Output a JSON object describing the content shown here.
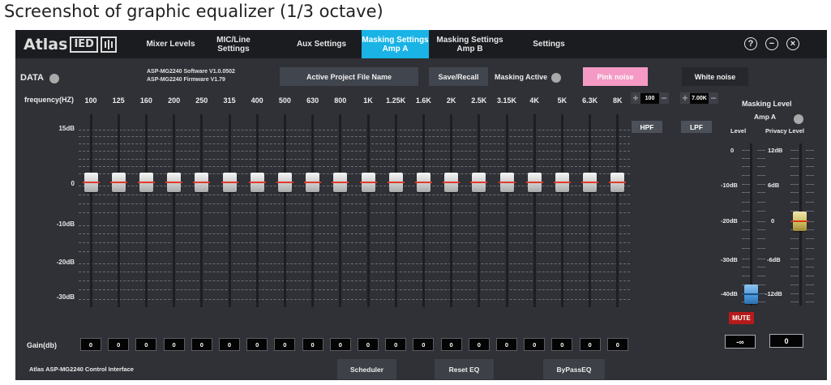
{
  "caption": "Screenshot of graphic equalizer (1/3 octave)",
  "logo": {
    "text": "Atlas",
    "box_text": "IED"
  },
  "nav": {
    "tabs": [
      {
        "label": "Mixer Levels",
        "active": false
      },
      {
        "label": "MIC/Line\nSettings",
        "active": false
      },
      {
        "label": "Aux Settings",
        "active": false
      },
      {
        "label": "Masking Settings\nAmp A",
        "active": true
      },
      {
        "label": "Masking Settings\nAmp B",
        "active": false
      },
      {
        "label": "Settings",
        "active": false
      }
    ],
    "icons": [
      "help-icon",
      "minimize-icon",
      "close-icon"
    ]
  },
  "status": {
    "data_label": "DATA",
    "software": "ASP-MG2240 Software V1.0.0502",
    "firmware": "ASP-MG2240 Firmware V1.79",
    "project_button": "Active Project File Name",
    "save_recall": "Save/Recall",
    "masking_active": "Masking Active",
    "pink_noise": "Pink noise",
    "white_noise": "White noise"
  },
  "eq": {
    "frequency_label": "frequency(HZ)",
    "frequencies": [
      "100",
      "125",
      "160",
      "200",
      "250",
      "315",
      "400",
      "500",
      "630",
      "800",
      "1K",
      "1.25K",
      "1.6K",
      "2K",
      "2.5K",
      "3.15K",
      "4K",
      "5K",
      "6.3K",
      "8K"
    ],
    "db_labels": [
      "15dB",
      "0",
      "-10dB",
      "-20dB",
      "-30dB"
    ],
    "gains": [
      "0",
      "0",
      "0",
      "0",
      "0",
      "0",
      "0",
      "0",
      "0",
      "0",
      "0",
      "0",
      "0",
      "0",
      "0",
      "0",
      "0",
      "0",
      "0",
      "0"
    ],
    "gain_label": "Gain(db)",
    "hpf": {
      "value": "100",
      "label": "HPF",
      "plus": "+",
      "minus": "−"
    },
    "lpf": {
      "value": "7.00K",
      "label": "LPF",
      "plus": "+",
      "minus": "−"
    }
  },
  "masking": {
    "title": "Masking Level",
    "amp": "Amp A",
    "level_label": "Level",
    "privacy_label": "Privacy Level",
    "level_scale": [
      "0",
      "-10dB",
      "-20dB",
      "-30dB",
      "-40dB"
    ],
    "privacy_scale": [
      "12dB",
      "6dB",
      "0",
      "-6dB",
      "-12dB"
    ],
    "mute": "MUTE",
    "level_value": "-∞",
    "privacy_value": "0"
  },
  "footer": {
    "app_name": "Atlas ASP-MG2240 Control Interface",
    "scheduler": "Scheduler",
    "reset_eq": "Reset EQ",
    "bypass_eq": "ByPassEQ"
  }
}
